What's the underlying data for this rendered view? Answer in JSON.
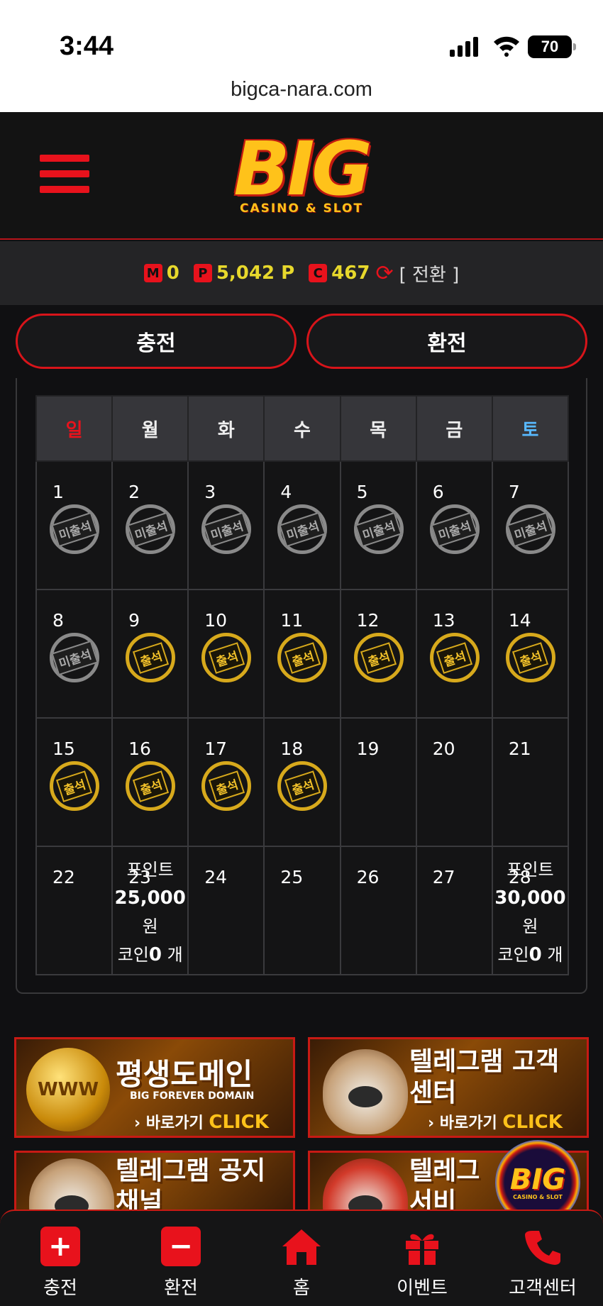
{
  "status": {
    "time": "3:44",
    "battery": "70",
    "url": "bigca-nara.com"
  },
  "header": {
    "logo_text": "BIG",
    "logo_sub": "CASINO & SLOT"
  },
  "balance": {
    "money_badge": "M",
    "money": "0",
    "point_badge": "P",
    "point": "5,042 P",
    "coin_badge": "C",
    "coin": "467",
    "convert_label": "[ 전환 ]"
  },
  "buttons": {
    "charge": "충전",
    "exchange": "환전"
  },
  "calendar": {
    "weekdays": [
      "일",
      "월",
      "화",
      "수",
      "목",
      "금",
      "토"
    ],
    "weeks": [
      [
        {
          "day": "1",
          "stamp": "미출석"
        },
        {
          "day": "2",
          "stamp": "미출석"
        },
        {
          "day": "3",
          "stamp": "미출석"
        },
        {
          "day": "4",
          "stamp": "미출석"
        },
        {
          "day": "5",
          "stamp": "미출석"
        },
        {
          "day": "6",
          "stamp": "미출석"
        },
        {
          "day": "7",
          "stamp": "미출석"
        }
      ],
      [
        {
          "day": "8",
          "stamp": "미출석"
        },
        {
          "day": "9",
          "stamp": "출석"
        },
        {
          "day": "10",
          "stamp": "출석"
        },
        {
          "day": "11",
          "stamp": "출석"
        },
        {
          "day": "12",
          "stamp": "출석"
        },
        {
          "day": "13",
          "stamp": "출석"
        },
        {
          "day": "14",
          "stamp": "출석"
        }
      ],
      [
        {
          "day": "15",
          "stamp": "출석"
        },
        {
          "day": "16",
          "stamp": "출석"
        },
        {
          "day": "17",
          "stamp": "출석"
        },
        {
          "day": "18",
          "stamp": "출석"
        },
        {
          "day": "19",
          "stamp": ""
        },
        {
          "day": "20",
          "stamp": ""
        },
        {
          "day": "21",
          "stamp": ""
        }
      ],
      [
        {
          "day": "22",
          "stamp": ""
        },
        {
          "day": "23",
          "stamp": "",
          "reward": {
            "line1": "포인트",
            "amount": "25,000",
            "unit": "원",
            "coin_prefix": "코인",
            "coin": "0",
            "coin_unit": "개"
          }
        },
        {
          "day": "24",
          "stamp": ""
        },
        {
          "day": "25",
          "stamp": ""
        },
        {
          "day": "26",
          "stamp": ""
        },
        {
          "day": "27",
          "stamp": ""
        },
        {
          "day": "28",
          "stamp": "",
          "reward": {
            "line1": "포인트",
            "amount": "30,000",
            "unit": "원",
            "coin_prefix": "코인",
            "coin": "0",
            "coin_unit": "개"
          }
        }
      ]
    ]
  },
  "banners": [
    {
      "title": "평생도메인",
      "sub": "BIG FOREVER DOMAIN",
      "cta": "› 바로가기",
      "cta_em": "CLICK",
      "art": "WWW"
    },
    {
      "title": "텔레그램 고객센터",
      "sub": "",
      "cta": "› 바로가기",
      "cta_em": "CLICK",
      "art": ""
    },
    {
      "title": "텔레그램 공지채널",
      "sub": "",
      "cta": "",
      "cta_em": "",
      "art": ""
    },
    {
      "title": "텔레그 서비",
      "sub": "",
      "cta": "",
      "cta_em": "",
      "art": ""
    }
  ],
  "fab": {
    "logo": "BIG",
    "sub": "CASINO & SLOT"
  },
  "nav": [
    {
      "label": "충전",
      "icon": "plus-icon"
    },
    {
      "label": "환전",
      "icon": "minus-icon"
    },
    {
      "label": "홈",
      "icon": "home-icon"
    },
    {
      "label": "이벤트",
      "icon": "gift-icon"
    },
    {
      "label": "고객센터",
      "icon": "phone-icon"
    }
  ]
}
